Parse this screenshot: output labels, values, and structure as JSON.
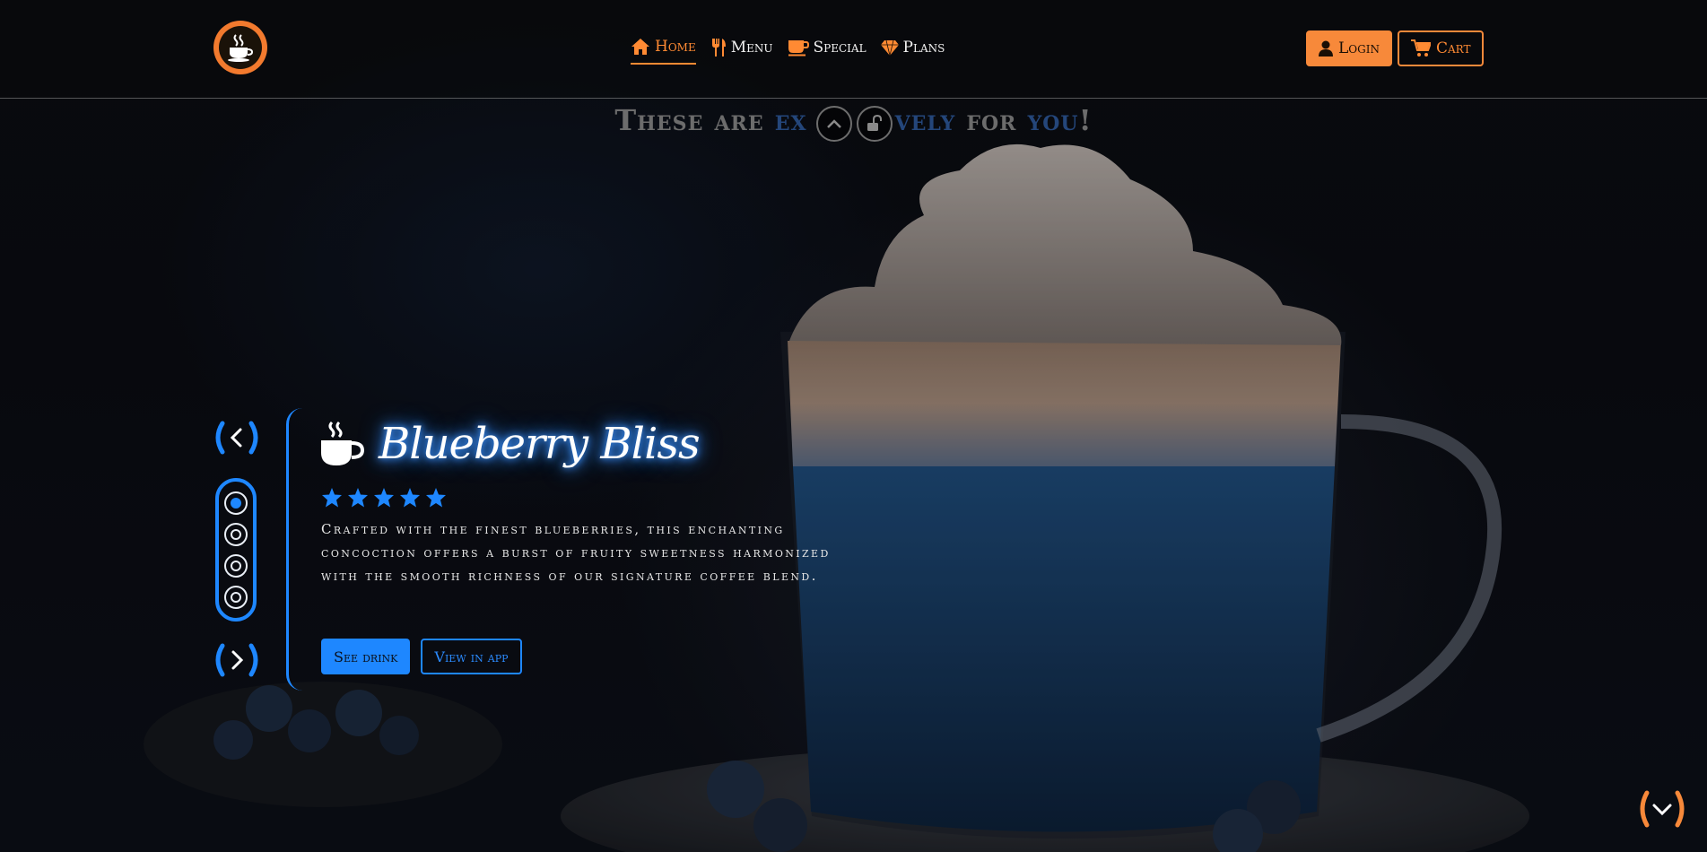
{
  "colors": {
    "accent_orange": "#f7893a",
    "accent_blue": "#1e87ff",
    "background": "#07090d"
  },
  "nav": {
    "logo_icon": "coffee-cup-icon",
    "links": [
      {
        "label": "Home",
        "icon": "home-icon",
        "active": true
      },
      {
        "label": "Menu",
        "icon": "cutlery-icon"
      },
      {
        "label": "Special",
        "icon": "mug-icon"
      },
      {
        "label": "Plans",
        "icon": "gem-icon"
      }
    ],
    "login_label": "Login",
    "cart_label": "Cart"
  },
  "subtitle": {
    "part1": "These are ",
    "part2": "ex",
    "part3": "vely",
    "part4": " for ",
    "part5": "you",
    "part6": "!"
  },
  "slider": {
    "prev_icon": "chevron-left-icon",
    "next_icon": "chevron-right-icon",
    "dot_count": 4,
    "active_index": 0
  },
  "product": {
    "title": "Blueberry Bliss",
    "title_icon": "steaming-cup-icon",
    "rating": 5,
    "description": "Crafted with the finest blueberries, this enchanting concoction offers a burst of fruity sweetness harmonized with the smooth richness of our signature coffee blend.",
    "see_label": "See drink",
    "app_label": "View in app"
  },
  "scroll_down_icon": "chevron-down-icon"
}
